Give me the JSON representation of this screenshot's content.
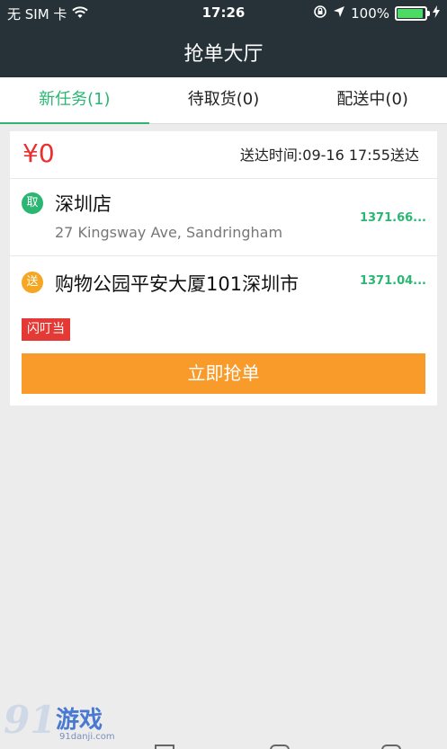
{
  "status_bar": {
    "carrier": "无 SIM 卡",
    "time": "17:26",
    "battery": "100%"
  },
  "header": {
    "title": "抢单大厅"
  },
  "tabs": [
    {
      "label": "新任务(1)",
      "active": true
    },
    {
      "label": "待取货(0)",
      "active": false
    },
    {
      "label": "配送中(0)",
      "active": false
    }
  ],
  "order": {
    "price": "¥0",
    "delivery_time": "送达时间:09-16 17:55送达",
    "pickup": {
      "icon_label": "取",
      "name": "深圳店",
      "address": "27 Kingsway Ave, Sandringham",
      "distance": "1371.66..."
    },
    "dropoff": {
      "icon_label": "送",
      "name": "购物公园平安大厦101深圳市",
      "distance": "1371.04..."
    },
    "platform_tag": "闪叮当",
    "grab_button": "立即抢单"
  },
  "watermark": {
    "number": "91",
    "text": "游戏",
    "site": "91danji.com"
  },
  "colors": {
    "header_bg": "#263238",
    "accent_green": "#2bb673",
    "price_red": "#e8302e",
    "button_orange": "#f99b2a",
    "tag_red": "#e53935",
    "drop_orange": "#f5a623"
  }
}
